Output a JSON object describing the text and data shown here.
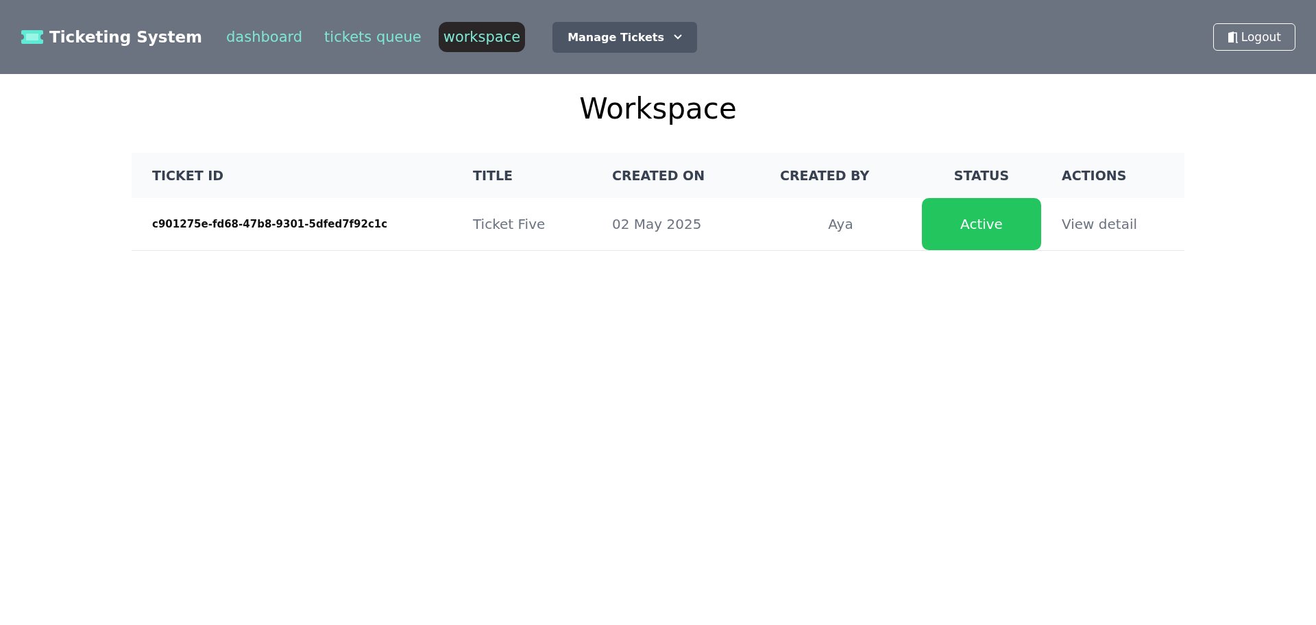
{
  "navbar": {
    "brand": "Ticketing System",
    "links": [
      {
        "label": "dashboard",
        "selected": false
      },
      {
        "label": "tickets queue",
        "selected": false
      },
      {
        "label": "workspace",
        "selected": true
      }
    ],
    "dropdown": {
      "label": "Manage Tickets",
      "expanded": false
    },
    "logout": "Logout"
  },
  "page_title": "Workspace",
  "table": {
    "columns": [
      "TICKET ID",
      "TITLE",
      "CREATED ON",
      "CREATED BY",
      "STATUS",
      "ACTIONS"
    ],
    "rows": [
      {
        "ticket_id": "c901275e-fd68-47b8-9301-5dfed7f92c1c",
        "title": "Ticket Five",
        "created_on": "02 May 2025",
        "created_by": "Aya",
        "status": {
          "label": "Active",
          "kind": "active"
        },
        "action": "View detail"
      }
    ]
  }
}
